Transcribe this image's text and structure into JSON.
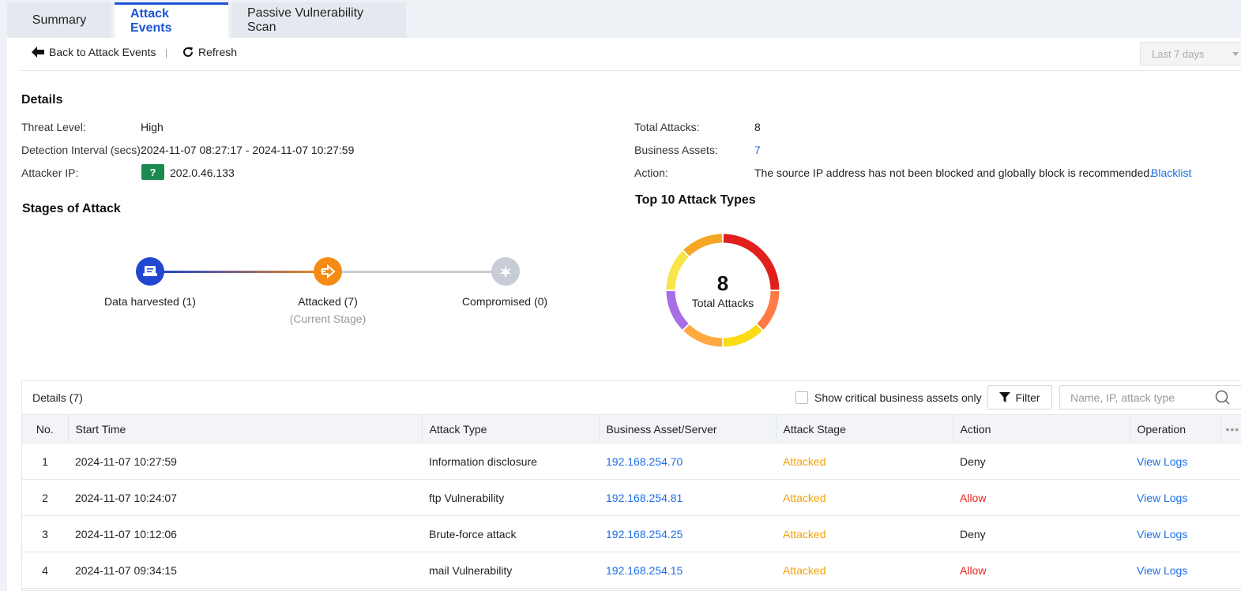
{
  "tabs": [
    "Summary",
    "Attack Events",
    "Passive Vulnerability Scan"
  ],
  "toolbar": {
    "back": "Back to Attack Events",
    "separator": "|",
    "refresh": "Refresh",
    "period": "Last 7 days"
  },
  "details": {
    "title": "Details",
    "threat_level_label": "Threat Level:",
    "threat_level": "High",
    "interval_label": "Detection Interval (secs):",
    "interval": "2024-11-07 08:27:17 - 2024-11-07 10:27:59",
    "attacker_ip_label": "Attacker IP:",
    "attacker_ip_badge": "?",
    "attacker_ip": "202.0.46.133",
    "total_attacks_label": "Total Attacks:",
    "total_attacks": "8",
    "business_assets_label": "Business Assets:",
    "business_assets": "7",
    "action_label": "Action:",
    "action": "The source IP address has not been blocked and globally block is recommended.",
    "action_link": "Blacklist"
  },
  "stages": {
    "title": "Stages of Attack",
    "items": [
      {
        "label": "Data harvested (1)",
        "color": "#2146d0",
        "icon": "data-harvested-icon"
      },
      {
        "label": "Attacked (7)",
        "sub": "(Current Stage)",
        "color": "#f58a14",
        "icon": "attacked-icon"
      },
      {
        "label": "Compromised (0)",
        "color": "#c8ccd6",
        "icon": "compromised-icon"
      }
    ]
  },
  "top_types": {
    "title": "Top 10 Attack Types",
    "center_value": "8",
    "center_label": "Total Attacks",
    "segments": [
      {
        "value": 2,
        "color": "#e0201c"
      },
      {
        "value": 1,
        "color": "#ff7a45"
      },
      {
        "value": 1,
        "color": "#fadb14"
      },
      {
        "value": 1,
        "color": "#ffa940"
      },
      {
        "value": 1,
        "color": "#a86ee6"
      },
      {
        "value": 1,
        "color": "#f7e54a"
      },
      {
        "value": 1,
        "color": "#f5a623"
      }
    ]
  },
  "table": {
    "title": "Details (7)",
    "checkbox_label": "Show critical business assets only",
    "filter_label": "Filter",
    "search_placeholder": "Name, IP, attack type",
    "columns": [
      "No.",
      "Start Time",
      "Attack Type",
      "Business Asset/Server",
      "Attack Stage",
      "Action",
      "Operation",
      "•••"
    ],
    "rows": [
      {
        "no": "1",
        "time": "2024-11-07 10:27:59",
        "type": "Information disclosure",
        "asset": "192.168.254.70",
        "stage": "Attacked",
        "action": "Deny",
        "op": "View Logs"
      },
      {
        "no": "2",
        "time": "2024-11-07 10:24:07",
        "type": "ftp Vulnerability",
        "asset": "192.168.254.81",
        "stage": "Attacked",
        "action": "Allow",
        "op": "View Logs"
      },
      {
        "no": "3",
        "time": "2024-11-07 10:12:06",
        "type": "Brute-force attack",
        "asset": "192.168.254.25",
        "stage": "Attacked",
        "action": "Deny",
        "op": "View Logs"
      },
      {
        "no": "4",
        "time": "2024-11-07 09:34:15",
        "type": "mail Vulnerability",
        "asset": "192.168.254.15",
        "stage": "Attacked",
        "action": "Allow",
        "op": "View Logs"
      }
    ]
  }
}
